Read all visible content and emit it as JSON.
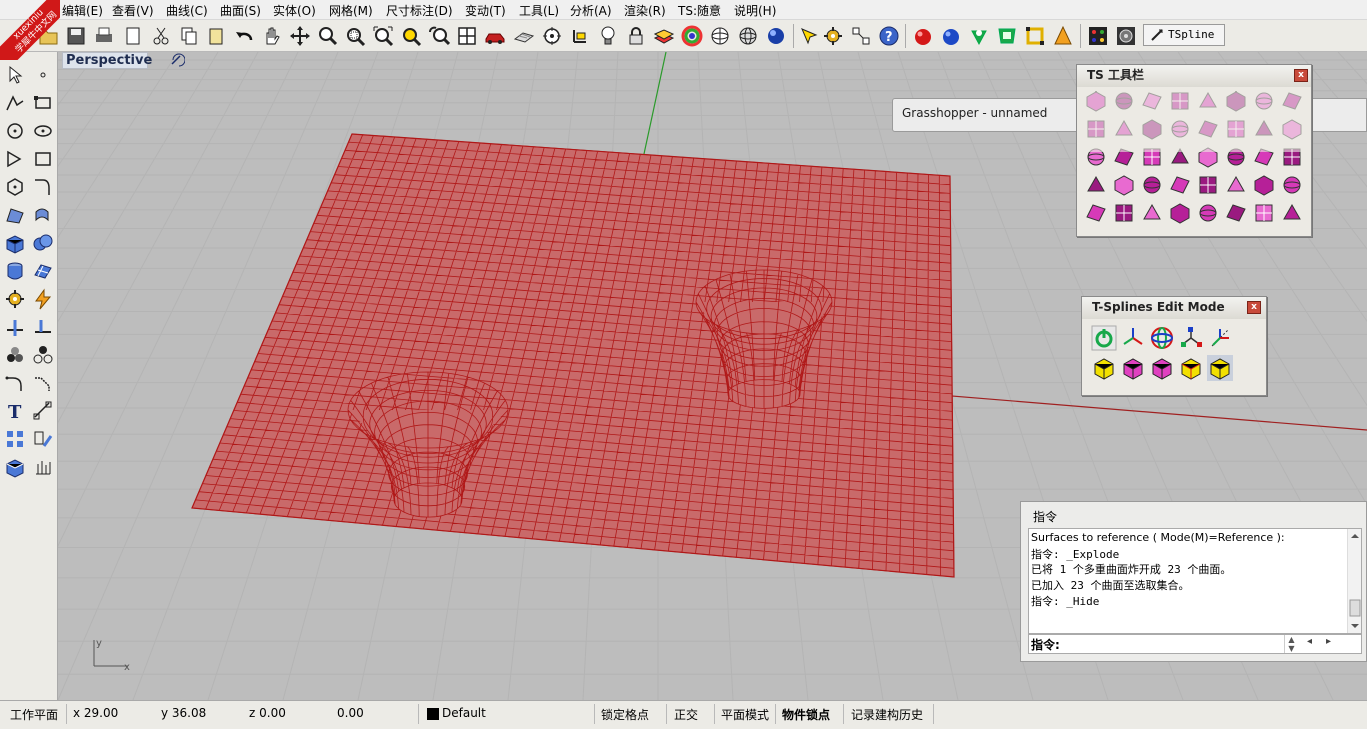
{
  "logo": {
    "text_en": "xuexiniu",
    "text_cn": "学犀牛中文网"
  },
  "menus": [
    "编辑(E)",
    "查看(V)",
    "曲线(C)",
    "曲面(S)",
    "实体(O)",
    "网格(M)",
    "尺寸标注(D)",
    "变动(T)",
    "工具(L)",
    "分析(A)",
    "渲染(R)",
    "TS:随意",
    "说明(H)"
  ],
  "toolbar": {
    "tspline_label": "TSpline"
  },
  "viewport": {
    "name": "Perspective",
    "axis_y": "y",
    "axis_x": "x"
  },
  "grasshopper": {
    "title": "Grasshopper - unnamed"
  },
  "ts_panel": {
    "title": "TS 工具栏",
    "close": "x"
  },
  "edit_panel": {
    "title": "T-Splines Edit Mode",
    "close": "x"
  },
  "command_panel": {
    "title": "指令",
    "log": [
      "Surfaces to reference ( Mode(M)=Reference ):",
      "指令: _Explode",
      "已将 1 个多重曲面炸开成 23 个曲面。",
      "已加入 23 个曲面至选取集合。",
      "指令: _Hide"
    ],
    "prompt_label": "指令:"
  },
  "statusbar": {
    "cplane": "工作平面",
    "x": "x 29.00",
    "y": "y 36.08",
    "z": "z 0.00",
    "d": "0.00",
    "layer": "Default",
    "toggles": [
      "锁定格点",
      "正交",
      "平面模式",
      "物件锁点",
      "记录建构历史"
    ]
  },
  "colors": {
    "mesh": "#b01818",
    "mesh_fill": "#c96a6a",
    "x_axis": "#a02020",
    "y_axis": "#2a9a2a",
    "grid": "#b4b4b4"
  }
}
